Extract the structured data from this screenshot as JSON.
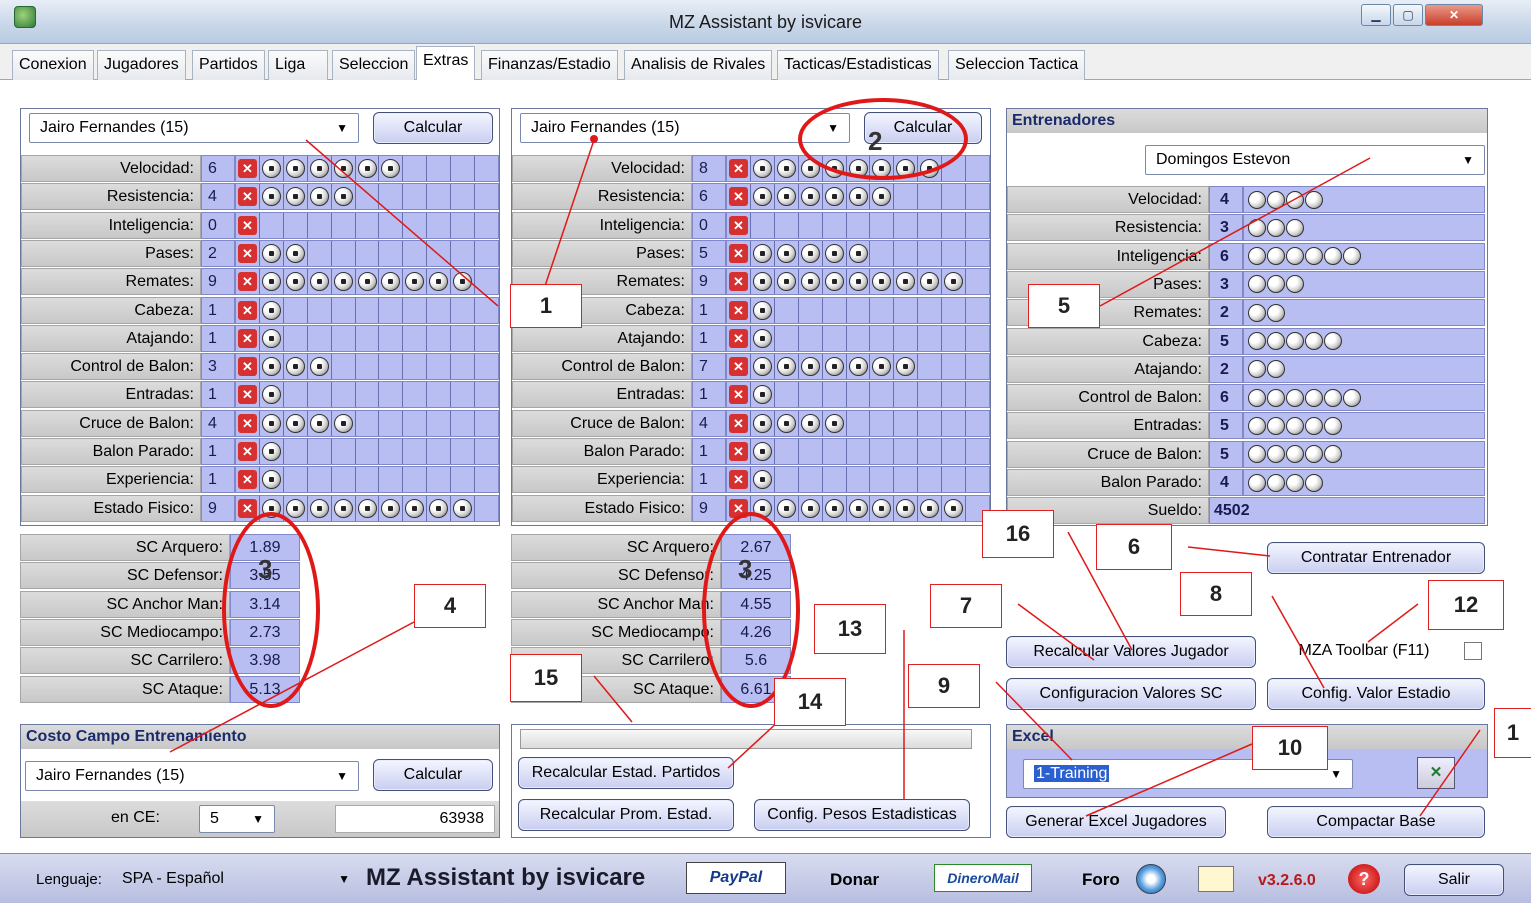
{
  "window": {
    "title": "MZ Assistant by isvicare",
    "controls": [
      "▁",
      "▢",
      "✕"
    ]
  },
  "tabs": [
    "Conexion",
    "Jugadores",
    "Partidos",
    "Liga",
    "Seleccion",
    "Extras",
    "Finanzas/Estadio",
    "Analisis de Rivales",
    "Tacticas/Estadisticas",
    "Seleccion Tactica"
  ],
  "active_tab": "Extras",
  "player1": {
    "name": "Jairo Fernandes (15)",
    "calc_label": "Calcular",
    "skills": [
      {
        "label": "Velocidad:",
        "value": "6"
      },
      {
        "label": "Resistencia:",
        "value": "4"
      },
      {
        "label": "Inteligencia:",
        "value": "0"
      },
      {
        "label": "Pases:",
        "value": "2"
      },
      {
        "label": "Remates:",
        "value": "9"
      },
      {
        "label": "Cabeza:",
        "value": "1"
      },
      {
        "label": "Atajando:",
        "value": "1"
      },
      {
        "label": "Control de Balon:",
        "value": "3"
      },
      {
        "label": "Entradas:",
        "value": "1"
      },
      {
        "label": "Cruce de Balon:",
        "value": "4"
      },
      {
        "label": "Balon Parado:",
        "value": "1"
      },
      {
        "label": "Experiencia:",
        "value": "1"
      },
      {
        "label": "Estado Fisico:",
        "value": "9"
      }
    ],
    "sc": [
      {
        "label": "SC Arquero:",
        "value": "1.89"
      },
      {
        "label": "SC Defensor:",
        "value": "3.55"
      },
      {
        "label": "SC Anchor Man:",
        "value": "3.14"
      },
      {
        "label": "SC Mediocampo:",
        "value": "2.73"
      },
      {
        "label": "SC Carrilero:",
        "value": "3.98"
      },
      {
        "label": "SC Ataque:",
        "value": "5.13"
      }
    ]
  },
  "player2": {
    "name": "Jairo Fernandes (15)",
    "calc_label": "Calcular",
    "skills": [
      {
        "label": "Velocidad:",
        "value": "8"
      },
      {
        "label": "Resistencia:",
        "value": "6"
      },
      {
        "label": "Inteligencia:",
        "value": "0"
      },
      {
        "label": "Pases:",
        "value": "5"
      },
      {
        "label": "Remates:",
        "value": "9"
      },
      {
        "label": "Cabeza:",
        "value": "1"
      },
      {
        "label": "Atajando:",
        "value": "1"
      },
      {
        "label": "Control de Balon:",
        "value": "7"
      },
      {
        "label": "Entradas:",
        "value": "1"
      },
      {
        "label": "Cruce de Balon:",
        "value": "4"
      },
      {
        "label": "Balon Parado:",
        "value": "1"
      },
      {
        "label": "Experiencia:",
        "value": "1"
      },
      {
        "label": "Estado Fisico:",
        "value": "9"
      }
    ],
    "sc": [
      {
        "label": "SC Arquero:",
        "value": "2.67"
      },
      {
        "label": "SC Defensor:",
        "value": "4.25"
      },
      {
        "label": "SC Anchor Man:",
        "value": "4.55"
      },
      {
        "label": "SC Mediocampo:",
        "value": "4.26"
      },
      {
        "label": "SC Carrilero:",
        "value": "5.6"
      },
      {
        "label": "SC Ataque:",
        "value": "6.61"
      }
    ]
  },
  "coach": {
    "title": "Entrenadores",
    "name": "Domingos Estevon",
    "skills": [
      {
        "label": "Velocidad:",
        "value": "4"
      },
      {
        "label": "Resistencia:",
        "value": "3"
      },
      {
        "label": "Inteligencia:",
        "value": "6"
      },
      {
        "label": "Pases:",
        "value": "3"
      },
      {
        "label": "Remates:",
        "value": "2"
      },
      {
        "label": "Cabeza:",
        "value": "5"
      },
      {
        "label": "Atajando:",
        "value": "2"
      },
      {
        "label": "Control de Balon:",
        "value": "6"
      },
      {
        "label": "Entradas:",
        "value": "5"
      },
      {
        "label": "Cruce de Balon:",
        "value": "5"
      },
      {
        "label": "Balon Parado:",
        "value": "4"
      }
    ],
    "salary_label": "Sueldo:",
    "salary_value": "4502"
  },
  "buttons": {
    "contratar": "Contratar Entrenador",
    "recalcular_valores": "Recalcular Valores Jugador",
    "mza_toolbar": "MZA Toolbar (F11)",
    "config_sc": "Configuracion Valores SC",
    "config_estadio": "Config. Valor Estadio",
    "recalc_partidos": "Recalcular Estad. Partidos",
    "recalc_prom": "Recalcular Prom. Estad.",
    "config_pesos": "Config. Pesos Estadisticas",
    "generar_excel": "Generar Excel Jugadores",
    "compactar": "Compactar Base"
  },
  "costo": {
    "title": "Costo Campo Entrenamiento",
    "player": "Jairo Fernandes (15)",
    "calc_label": "Calcular",
    "ce_label": "en CE:",
    "ce_value": "5",
    "total": "63938"
  },
  "excel": {
    "title": "Excel",
    "selected": "1-Training"
  },
  "bottom": {
    "language_label": "Lenguaje:",
    "language_value": "SPA - Español",
    "brand": "MZ Assistant by isvicare",
    "paypal": "PayPal",
    "donar": "Donar",
    "dineromail": "DineroMail",
    "foro": "Foro",
    "version": "v3.2.6.0",
    "salir": "Salir"
  },
  "annotations": [
    "1",
    "2",
    "3",
    "3",
    "4",
    "5",
    "6",
    "7",
    "8",
    "9",
    "10",
    "1",
    "12",
    "13",
    "14",
    "15",
    "16"
  ],
  "colors": {
    "bar": "#b8bef2",
    "annotation": "#e01818"
  }
}
